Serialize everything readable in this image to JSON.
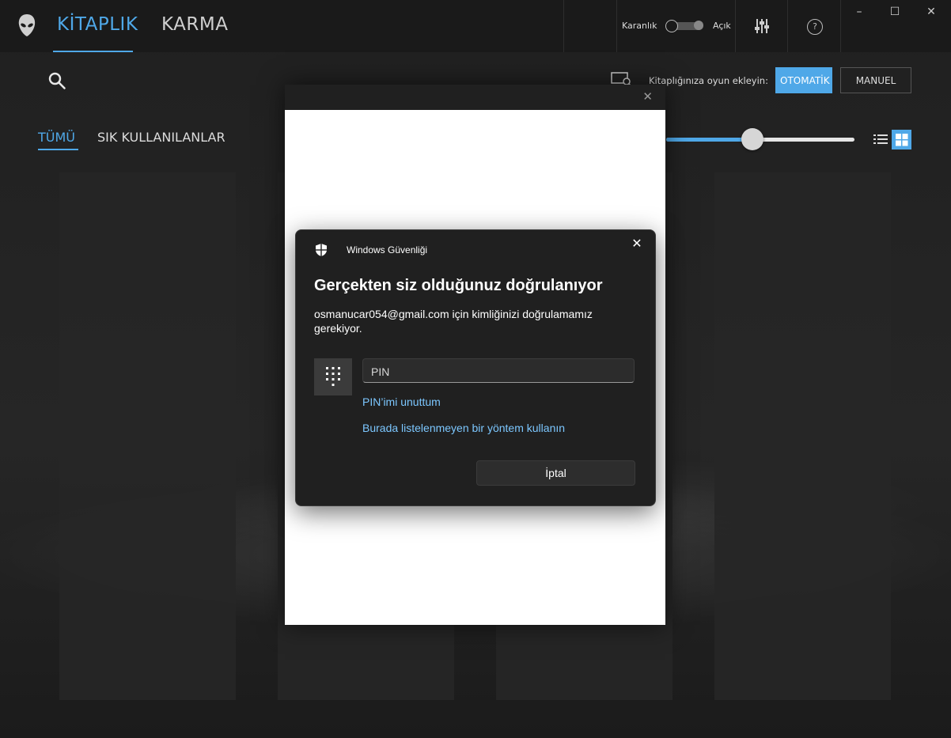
{
  "app": {
    "tabs": [
      {
        "label": "KİTAPLIK"
      },
      {
        "label": "KARMA"
      }
    ],
    "theme_toggle": {
      "off_label": "Karanlık",
      "on_label": "Açık"
    },
    "help_label": "?",
    "window_controls": {
      "minimize": "–",
      "maximize": "☐",
      "close": "✕"
    },
    "colors": {
      "accent": "#4fa8e8",
      "background": "#1f1f1f"
    }
  },
  "toolbar": {
    "add_games_label": "Kitaplığınıza oyun ekleyin:",
    "auto_button": "OTOMATİK",
    "manual_button": "MANUEL"
  },
  "filters": {
    "all": "TÜMÜ",
    "favorites": "SIK KULLANILANLAR"
  },
  "size_slider": {
    "value_fraction": 0.46
  },
  "view_mode": "grid",
  "host_window": {
    "close": "✕"
  },
  "dialog": {
    "app_name": "Windows Güvenliği",
    "close": "✕",
    "title": "Gerçekten siz olduğunuz doğrulanıyor",
    "description": "osmanucar054@gmail.com için kimliğinizi doğrulamamız gerekiyor.",
    "pin_placeholder": "PIN",
    "forgot_pin_link": "PIN’imi unuttum",
    "other_method_link": "Burada listelenmeyen bir yöntem kullanın",
    "cancel_button": "İptal"
  },
  "icons": [
    "alien-logo-icon",
    "equalizer-icon",
    "help-icon",
    "search-icon",
    "monitor-search-icon",
    "list-view-icon",
    "grid-view-icon",
    "shield-icon",
    "keypad-icon",
    "close-icon"
  ]
}
